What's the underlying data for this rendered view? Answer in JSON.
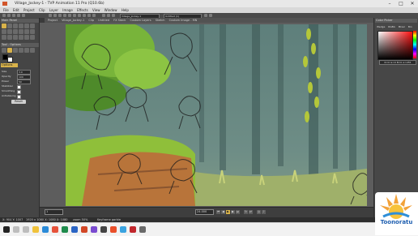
{
  "window": {
    "title": "Village_Jockey-1 - TVP Animation 11 Pro (Q10.6b)",
    "controls": [
      "–",
      "□",
      "✕"
    ]
  },
  "menubar": [
    "File",
    "Edit",
    "Project",
    "Clip",
    "Layer",
    "Image",
    "Effects",
    "View",
    "Window",
    "Help"
  ],
  "toolbar": {
    "clip_selector": "Village_Jockey-1",
    "layer_selector": "Untitled (1)"
  },
  "tabs": [
    "Project",
    "Village_Jockey-1",
    "Clip",
    "Untitled",
    "FX Stack",
    "Custom Layers",
    "Sketch",
    "Custom Image - MN"
  ],
  "left_panel": {
    "tools_header": "Main Panel",
    "tools2_header": "Tool - Options",
    "options_tab": "Options",
    "options": [
      {
        "label": "Size",
        "value": "3.0"
      },
      {
        "label": "Opacity",
        "value": "100"
      },
      {
        "label": "Power",
        "value": "50"
      },
      {
        "label": "Stabilizer",
        "value": ""
      },
      {
        "label": "Smoothing",
        "value": ""
      },
      {
        "label": "Antialiasing",
        "value": ""
      }
    ],
    "reset_label": "Reset"
  },
  "right_panel": {
    "header": "Color Picker",
    "tabs": [
      "Wedge",
      "RGBA",
      "Mixer",
      "Bin"
    ],
    "value_field": "R=0 G=0 B=0 A=255"
  },
  "timeline": {
    "frame": "1",
    "fps": "24.000"
  },
  "statusbar": {
    "coords": "X: 904  Y: 1007",
    "size": "1920 x 1080  X: 1080  X: 1080",
    "zoom": "zoom 50%",
    "layer": "Keyframe garbie"
  },
  "logo": {
    "text": "Toonoratu"
  },
  "colors": {
    "accent": "#d8b24a",
    "panel": "#454545",
    "forest": "#4f6f6e",
    "grass": "#8fbf3a"
  }
}
